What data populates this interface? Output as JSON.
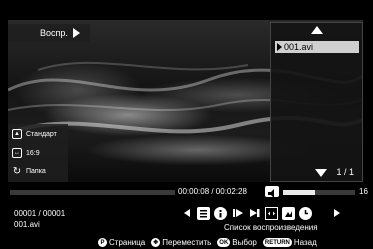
{
  "player": {
    "play_label": "Воспр.",
    "progress_fraction": 0.0,
    "time": "00:00:08 / 00:02:28",
    "volume_value": "16",
    "volume_fraction": 0.45,
    "counter": "00001 / 00001",
    "filename": "001.avi",
    "playlist_caption": "Список воспроизведения"
  },
  "playlist": {
    "items": [
      {
        "label": "001.avi",
        "selected": true
      }
    ],
    "page": "1 / 1"
  },
  "settings": {
    "mode": "Стандарт",
    "aspect": "16:9",
    "folder": "Папка"
  },
  "controls": [
    "prev-icon",
    "info-list-icon",
    "info-icon",
    "play-icon",
    "skip-forward-icon",
    "aspect-icon",
    "picture-mode-icon",
    "timer-icon",
    "next-icon"
  ],
  "footer": {
    "page_key": "P",
    "page_label": "Страница",
    "move_label": "Переместить",
    "ok_key": "OK",
    "ok_label": "Выбор",
    "return_key": "RETURN",
    "return_label": "Назад"
  },
  "colors": {
    "highlight": "#d0d0d0",
    "background": "#000000",
    "text": "#ffffff"
  }
}
